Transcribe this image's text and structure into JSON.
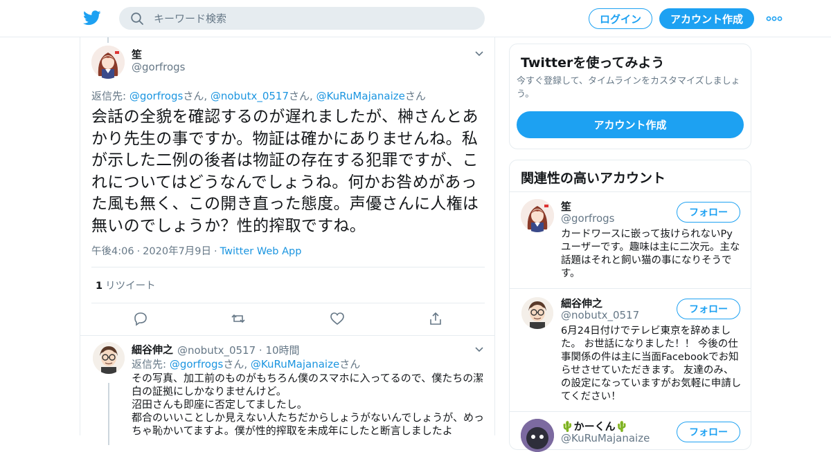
{
  "header": {
    "logo_icon": "twitter-bird-icon",
    "search_placeholder": "キーワード検索",
    "login_label": "ログイン",
    "signup_label": "アカウント作成",
    "more_icon": "more-dots-icon"
  },
  "tweet": {
    "name": "笙",
    "handle": "@gorfrogs",
    "reply_prefix": "返信先: ",
    "reply_to": [
      {
        "handle": "@gorfrogs",
        "suffix": "さん, "
      },
      {
        "handle": "@nobutx_0517",
        "suffix": "さん, "
      },
      {
        "handle": "@KuRuMajanaize",
        "suffix": "さん"
      }
    ],
    "text": "会話の全貌を確認するのが遅れましたが、榊さんとあかり先生の事ですか。物証は確かにありませんね。私が示した二例の後者は物証の存在する犯罪ですが、これについてはどうなんでしょうね。何かお咎めがあった風も無く、この開き直った態度。声優さんに人権は無いのでしょうか？性的搾取ですね。",
    "time": "午後4:06",
    "date": "2020年7月9日",
    "source": "Twitter Web App",
    "retweet_count": "1",
    "retweet_label": "リツイート"
  },
  "reply": {
    "name": "細谷伸之",
    "handle_time": "@nobutx_0517 · 10時間",
    "reply_prefix": "返信先: ",
    "reply_to": [
      {
        "handle": "@gorfrogs",
        "suffix": "さん, "
      },
      {
        "handle": "@KuRuMajanaize",
        "suffix": "さん"
      }
    ],
    "lines": [
      "その写真、加工前のものがもちろん僕のスマホに入ってるので、僕たちの潔白の証拠にしかなりませんけど。",
      "沼田さんも即座に否定してましたし。",
      "都合のいいことしか見えない人たちだからしょうがないんでしょうが、めっちゃ恥かいてますよ。僕が性的搾取を未成年にしたと断言しましたよ"
    ]
  },
  "sidebar": {
    "signup_card": {
      "title": "Twitterを使ってみよう",
      "desc": "今すぐ登録して、タイムラインをカスタマイズしましょう。",
      "button": "アカウント作成"
    },
    "related": {
      "title": "関連性の高いアカウント",
      "follow_label": "フォロー",
      "accounts": [
        {
          "name": "笙",
          "handle": "@gorfrogs",
          "bio": "カードワースに嵌って抜けられないPyユーザーです。趣味は主に二次元。主な話題はそれと飼い猫の事になりそうです。"
        },
        {
          "name": "細谷伸之",
          "handle": "@nobutx_0517",
          "bio": "6月24日付けでテレビ東京を辞めました。 お世話になりました！！ 今後の仕事関係の件は主に当面Facebookでお知らせさせていただきます。 友達のみ、の設定になっていますがお気軽に申請してください！"
        },
        {
          "name": "🌵かーくん🌵",
          "handle": "@KuRuMajanaize",
          "bio": ""
        }
      ]
    }
  },
  "colors": {
    "accent": "#1da1f2",
    "link": "#1b95e0",
    "muted": "#657786",
    "border": "#e6ecf0"
  }
}
